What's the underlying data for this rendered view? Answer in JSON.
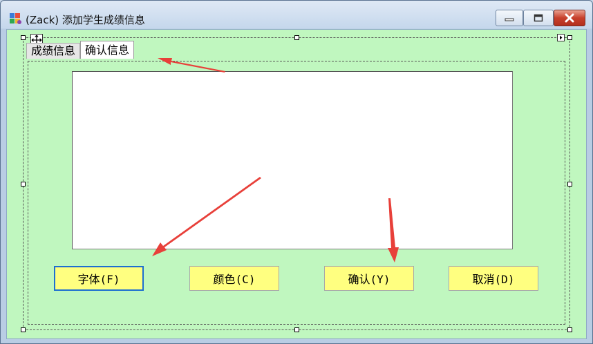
{
  "window": {
    "title": "(Zack)  添加学生成绩信息"
  },
  "tabs": [
    {
      "label": "成绩信息",
      "active": false
    },
    {
      "label": "确认信息",
      "active": true
    }
  ],
  "textarea": {
    "value": ""
  },
  "buttons": {
    "font": "字体(F)",
    "color": "颜色(C)",
    "confirm": "确认(Y)",
    "cancel": "取消(D)"
  },
  "colors": {
    "form_background": "#c0f7bf",
    "button_background": "#ffff80",
    "focus_border": "#1d6fd1",
    "annotation_arrow": "#e8403a"
  }
}
